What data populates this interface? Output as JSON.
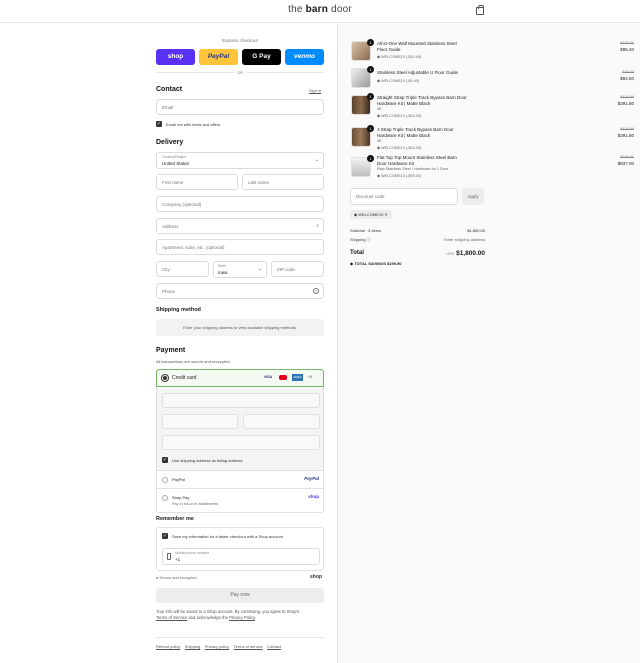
{
  "header": {
    "logo_pre": "the ",
    "logo_bold": "barn",
    "logo_post": " door",
    "bag_icon": "shopping-bag-icon"
  },
  "express": {
    "label": "Express checkout",
    "buttons": [
      {
        "label": "shop",
        "color": "#5a31f4"
      },
      {
        "label": "PayPal",
        "color": "#ffc439"
      },
      {
        "label": "G Pay",
        "color": "#000000"
      },
      {
        "label": "venmo",
        "color": "#008cff"
      }
    ],
    "or": "OR"
  },
  "contact": {
    "title": "Contact",
    "signin": "Sign in",
    "email_placeholder": "Email",
    "newsletter": "Email me with news and offers"
  },
  "delivery": {
    "title": "Delivery",
    "country_label": "Country/Region",
    "country_value": "United States",
    "first_name": "First name",
    "last_name": "Last name",
    "company": "Company (optional)",
    "address": "Address",
    "apartment": "Apartment, suite, etc. (optional)",
    "city": "City",
    "state_label": "State",
    "state_value": "Iowa",
    "zip": "ZIP code",
    "phone": "Phone"
  },
  "shipping": {
    "title": "Shipping method",
    "message": "Enter your shipping address to view available shipping methods."
  },
  "payment": {
    "title": "Payment",
    "subtitle": "All transactions are secure and encrypted.",
    "credit_card": "Credit card",
    "card_brands": [
      "VISA",
      "MC",
      "AMEX",
      "+5"
    ],
    "billing_same": "Use shipping address as billing address",
    "paypal": "PayPal",
    "paypal_logo": "PayPal",
    "shop_pay": "Shop Pay",
    "shop_pay_sub": "Pay in full or in installments",
    "shop_pay_logo": "shop"
  },
  "remember": {
    "title": "Remember me",
    "save_info": "Save my information for a faster checkout with a Shop account",
    "mobile_label": "Mobile phone number",
    "mobile_value": "+1",
    "secure": "Secure and encrypted",
    "shop_logo": "shop"
  },
  "pay_now": "Pay now",
  "legal": {
    "text1": "Your info will be saved to a Shop account. By continuing, you agree to Shop's",
    "tos": "Terms of Service",
    "and": " and acknowledge the ",
    "privacy": "Privacy Policy",
    "end": "."
  },
  "footer": [
    "Refund policy",
    "Shipping",
    "Privacy policy",
    "Terms of service",
    "Contact"
  ],
  "cart": {
    "items": [
      {
        "qty": "1",
        "name": "All-in-One Wall Mounted Stainless Steel Floor Guide",
        "variant": "",
        "discount": "WELCOME10 (-$10.45)",
        "original": "$105.00",
        "price": "$95.40"
      },
      {
        "qty": "1",
        "name": "Stainless Steel Adjustable U Floor Guide",
        "variant": "",
        "discount": "WELCOME10 (-$9.40)",
        "original": "$94.00",
        "price": "$84.60"
      },
      {
        "qty": "1",
        "name": "Straight Strap Triple Track Bypass Barn Door Hardware Kit | Matte Black",
        "variant": "4ft",
        "discount": "WELCOME10 (-$43.49)",
        "original": "$434.99",
        "price": "$391.50"
      },
      {
        "qty": "1",
        "name": "J-Strap Triple Track Bypass Barn Door Hardware Kit | Matte Black",
        "variant": "4ft",
        "discount": "WELCOME10 (-$43.49)",
        "original": "$434.99",
        "price": "$391.50"
      },
      {
        "qty": "1",
        "name": "Flat Top Top Mount Stainless Steel Barn Door Hardware Kit",
        "variant": "Raw Stainless Steel / Hardware for 1 Door",
        "discount": "WELCOME10 (-$93.00)",
        "original": "$930.00",
        "price": "$837.00"
      }
    ],
    "discount_placeholder": "Discount code",
    "apply": "Apply",
    "applied_code": "WELCOME10",
    "subtotal_label": "Subtotal · 5 items",
    "subtotal": "$1,800.00",
    "shipping_label": "Shipping",
    "shipping_value": "Enter shipping address",
    "total_label": "Total",
    "currency": "USD",
    "total": "$1,800.00",
    "savings_label": "TOTAL SAVINGS",
    "savings": "$199.90"
  }
}
